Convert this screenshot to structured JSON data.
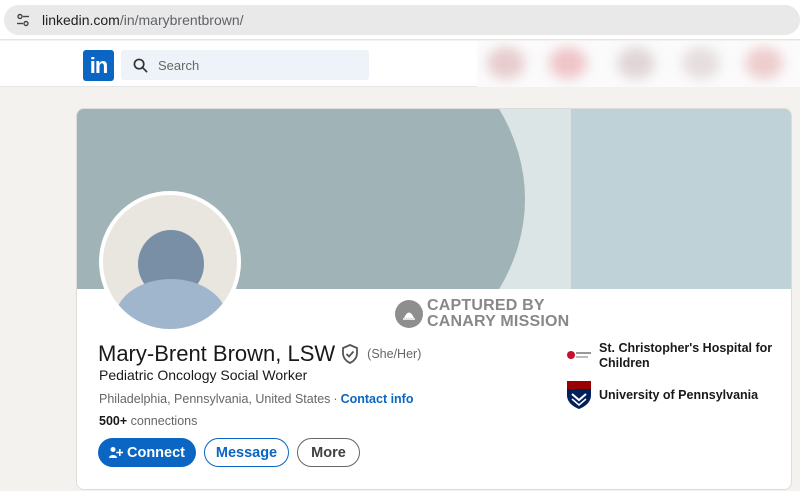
{
  "browser": {
    "url_host": "linkedin.com",
    "url_path": "/in/marybrentbrown/"
  },
  "nav": {
    "logo_text": "in",
    "search_placeholder": "Search"
  },
  "profile": {
    "name": "Mary-Brent Brown, LSW",
    "pronouns": "(She/Her)",
    "headline": "Pediatric Oncology Social Worker",
    "location": "Philadelphia, Pennsylvania, United States",
    "separator": "·",
    "contact_info": "Contact info",
    "connections_count": "500+",
    "connections_label": "connections"
  },
  "actions": {
    "connect": "Connect",
    "message": "Message",
    "more": "More"
  },
  "organizations": [
    {
      "name": "St. Christopher's Hospital for Children",
      "logo": "hospital-logo"
    },
    {
      "name": "University of Pennsylvania",
      "logo": "penn-shield-logo"
    }
  ],
  "watermark": {
    "line1": "CAPTURED BY",
    "line2": "CANARY MISSION"
  },
  "colors": {
    "brand": "#0a66c2",
    "banner": "#a0b3b6"
  }
}
